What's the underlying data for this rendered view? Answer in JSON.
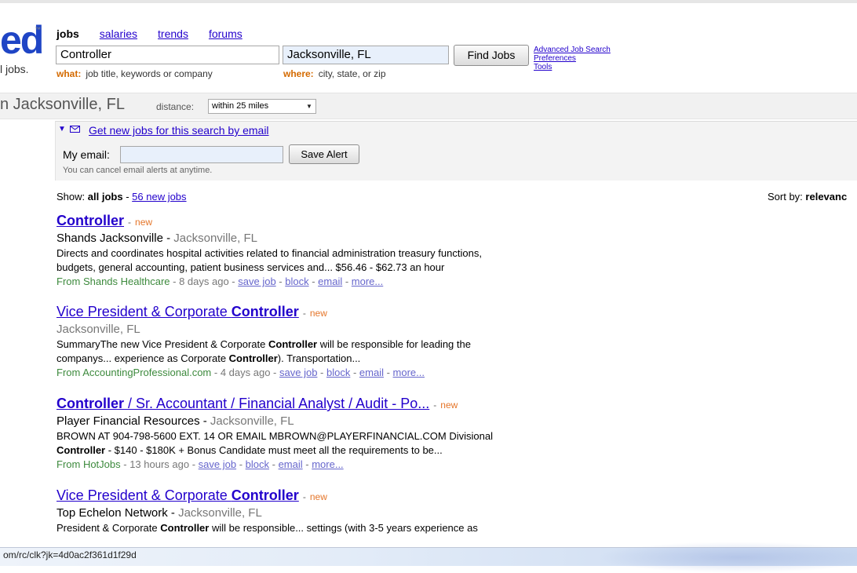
{
  "logo": {
    "mark": "ed",
    "tagline": "l jobs."
  },
  "nav": {
    "jobs": "jobs",
    "salaries": "salaries",
    "trends": "trends",
    "forums": "forums"
  },
  "search": {
    "what_value": "Controller",
    "where_value": "Jacksonville, FL",
    "what_hint_label": "what:",
    "what_hint": "job title, keywords or company",
    "where_hint_label": "where:",
    "where_hint": "city, state, or zip",
    "find_button": "Find Jobs",
    "advanced_link": "Advanced Job Search",
    "preferences_link": "Preferences",
    "tools_link": "Tools"
  },
  "location_bar": {
    "title": "n Jacksonville, FL",
    "distance_label": "distance:",
    "distance_value": "within 25 miles"
  },
  "alert": {
    "link": "Get new jobs for this search by email",
    "email_label": "My email:",
    "email_value": "",
    "save_button": "Save Alert",
    "note": "You can cancel email alerts at anytime."
  },
  "results_header": {
    "show_label": "Show:",
    "all_jobs": "all jobs",
    "separator": "-",
    "new_jobs_link": "56 new jobs",
    "sort_label": "Sort by:",
    "sort_value": "relevanc"
  },
  "jobs": [
    {
      "title_plain": "",
      "title_bold": "Controller",
      "title_rest": "",
      "new": "new",
      "company": "Shands Jacksonville",
      "location": "Jacksonville, FL",
      "snippet_1": "Directs and coordinates hospital activities related to financial administration treasury functions,",
      "snippet_2": "budgets, general accounting, patient business services and... $56.46 - $62.73 an hour",
      "source": "From Shands Healthcare",
      "age": "8 days ago",
      "save": "save job",
      "block": "block",
      "email": "email",
      "more": "more..."
    },
    {
      "title_plain": "Vice President & Corporate ",
      "title_bold": "Controller",
      "title_rest": "",
      "new": "new",
      "company": "",
      "location": "Jacksonville, FL",
      "snippet_1a": "SummaryThe new Vice President & Corporate ",
      "snippet_1b": "Controller",
      "snippet_1c": " will be responsible for leading the",
      "snippet_2a": "companys... experience as Corporate ",
      "snippet_2b": "Controller",
      "snippet_2c": "). Transportation...",
      "source": "From AccountingProfessional.com",
      "age": "4 days ago",
      "save": "save job",
      "block": "block",
      "email": "email",
      "more": "more..."
    },
    {
      "title_plain": "",
      "title_bold": "Controller",
      "title_rest": " / Sr. Accountant / Financial Analyst / Audit - Po...",
      "new": "new",
      "company": "Player Financial Resources",
      "location": "Jacksonville, FL",
      "snippet_1": "BROWN AT 904-798-5600 EXT. 14 OR EMAIL MBROWN@PLAYERFINANCIAL.COM   Divisional",
      "snippet_2a": "Controller",
      "snippet_2b": " - $140 - $180K + Bonus Candidate must meet all the requirements to be...",
      "source": "From HotJobs",
      "age": "13 hours ago",
      "save": "save job",
      "block": "block",
      "email": "email",
      "more": "more..."
    },
    {
      "title_plain": "Vice President & Corporate ",
      "title_bold": "Controller",
      "title_rest": "",
      "new": "new",
      "company": "Top Echelon Network",
      "location": "Jacksonville, FL",
      "snippet_1a": "President & Corporate ",
      "snippet_1b": "Controller",
      "snippet_1c": " will be responsible... settings (with 3-5 years experience as"
    }
  ],
  "status_bar": {
    "url": "om/rc/clk?jk=4d0ac2f361d1f29d"
  },
  "colors": {
    "link": "#2200cc",
    "new": "#e5762a",
    "source": "#3d8a3d",
    "accent": "#d46a00"
  }
}
